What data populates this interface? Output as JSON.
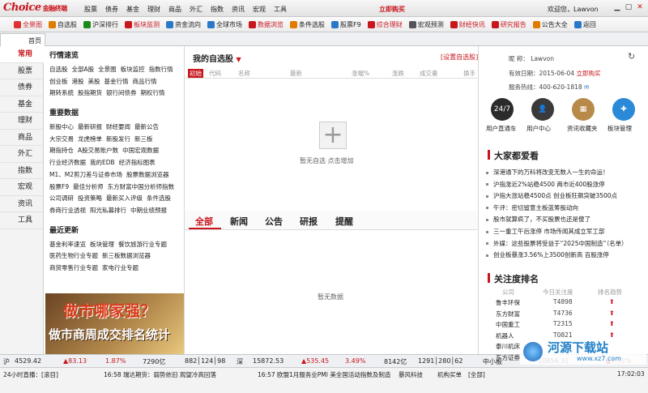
{
  "app": {
    "logo": "Choice",
    "logo_sub": "金融终端",
    "open_account": "立即购买",
    "welcome": "欢迎您，Lawvon"
  },
  "menu": [
    "股票",
    "债券",
    "基金",
    "理财",
    "商品",
    "外汇",
    "指数",
    "资讯",
    "宏观",
    "工具"
  ],
  "toolbar": [
    {
      "label": "全景图",
      "red": true
    },
    {
      "label": "自选股",
      "red": false
    },
    {
      "label": "沪深排行",
      "red": false
    },
    {
      "label": "板块监测",
      "red": true
    },
    {
      "label": "资金流向",
      "red": false
    },
    {
      "label": "全球市场",
      "red": false
    },
    {
      "label": "数据浏览",
      "red": true
    },
    {
      "label": "条件选股",
      "red": false
    },
    {
      "label": "股票F9",
      "red": false
    },
    {
      "label": "综合理财",
      "red": true
    },
    {
      "label": "宏观预测",
      "red": false
    },
    {
      "label": "财经快讯",
      "red": true
    },
    {
      "label": "研究报告",
      "red": true
    },
    {
      "label": "公告大全",
      "red": false
    },
    {
      "label": "返回",
      "red": false
    }
  ],
  "tab_home": "首页",
  "leftnav": [
    "常用",
    "股票",
    "债券",
    "基金",
    "理财",
    "商品",
    "外汇",
    "指数",
    "宏观",
    "资讯",
    "工具"
  ],
  "quick": {
    "sec1_title": "行情速览",
    "sec1_rows": [
      [
        "自选股",
        "全部A股",
        "全景图",
        "板块监控",
        "指数行情"
      ],
      [
        "创业板",
        "港股",
        "美股",
        "基金行情",
        "商品行情"
      ],
      [
        "期转系统",
        "股指期货",
        "银行间债券",
        "期权行情"
      ]
    ],
    "sec2_title": "重要数据",
    "sec2_rows": [
      [
        "新股中心",
        "最新研报",
        "财经要闻",
        "最新公告"
      ],
      [
        "大宗交易",
        "龙虎榜单",
        "新股发行",
        "新三板"
      ],
      [
        "期指持仓",
        "A股交易账户数",
        "中国宏观数据"
      ],
      [
        "行业经济数据",
        "我的EDB",
        "经济指标图表"
      ],
      [
        "M1、M2剪刀差与证券市场",
        "股票数据浏览器"
      ],
      [
        "股票F9",
        "最佳分析师",
        "东方财富中国分析师指数"
      ],
      [
        "公司调研",
        "投资策略",
        "最新买入评级",
        "条件选股"
      ],
      [
        "券商行业透视",
        "阳光私募排行",
        "中期业绩预报"
      ]
    ],
    "sec3_title": "最近更新",
    "sec3_rows": [
      [
        "基金利率速览",
        "板块管理",
        "餐饮旅游行业专题"
      ],
      [
        "医药生物行业专题",
        "新三板数据浏览器"
      ],
      [
        "商贸零售行业专题",
        "家电行业专题"
      ]
    ],
    "banner1": "做市哪家强？",
    "banner2": "做市商周成交排名统计"
  },
  "watch": {
    "title": "我的自选股",
    "set": "[设置自选股]",
    "cols": [
      "初始",
      "代码",
      "名称",
      "最新",
      "涨幅%",
      "涨跌",
      "成交量",
      "换手"
    ],
    "add_text": "暂无自选   点击增加"
  },
  "news": {
    "tabs": [
      "全部",
      "新闻",
      "公告",
      "研报",
      "提醒"
    ],
    "empty": "暂无数据"
  },
  "user": {
    "nick_label": "昵        称：",
    "nick": "Lawvon",
    "expiry_label": "有效日期：",
    "expiry": "2015-06-04",
    "buy": "立即购买",
    "hotline_label": "服务热线：",
    "hotline": "400-620-1818"
  },
  "services": [
    "用户直通车",
    "用户中心",
    "资讯收藏夹",
    "板块管理"
  ],
  "hot": {
    "title": "大家都爱看",
    "items": [
      "深港通下的万科将改变无数人一生的命运！",
      "沪指涨近2%站稳4500 两市近400股涨停",
      "沪指大涨站稳4500点 创业板狂飙突破3500点",
      "午评：密切留意主板蓝筹股动向",
      "股市就算疯了，不买股票也还是傻了",
      "三一重工午后涨停 市场传闻其成立军工部",
      "外媒：这些股票将受益于“2025中国制造”（名单）",
      "创业板暴涨3.56%上3500创新高 百股涨停"
    ]
  },
  "focus": {
    "title": "关注度排名",
    "cols": [
      "公司",
      "今日关注度",
      "排名趋势"
    ],
    "rows": [
      [
        "鲁丰环保",
        "T4898"
      ],
      [
        "东方财富",
        "T4736"
      ],
      [
        "中国重工",
        "T2315"
      ],
      [
        "机器人",
        "T0821"
      ],
      [
        "泰川机床",
        ""
      ],
      [
        "东方证券",
        ""
      ]
    ]
  },
  "status1": {
    "sh_label": "沪",
    "sh": "4529.42",
    "sh_chg": "▲83.13",
    "sh_pct": "1.87%",
    "sh_amt": "7290亿",
    "sh_updn": "882│124│98",
    "sz_label": "深",
    "sz": "15872.53",
    "sz_chg": "▲535.45",
    "sz_pct": "3.49%",
    "sz_amt": "8142亿",
    "sz_updn": "1291│280│62",
    "zx_label": "中小板",
    "zx": "10856.31",
    "zx_pct": "▲4.52%"
  },
  "status2": {
    "live": "24小时直播：[滚目]",
    "news1": "16:58 瑞达期货：弱势依旧 观望冷高回落",
    "news2": "16:57 欧盟1月服务业PMI 美全国活动指数及制造",
    "news3": "暴风科技",
    "buy": "机构买单",
    "all": "[全部]",
    "time": "17:02:03"
  },
  "watermark": {
    "brand": "河源下载站",
    "url": "www.xz7.com"
  }
}
